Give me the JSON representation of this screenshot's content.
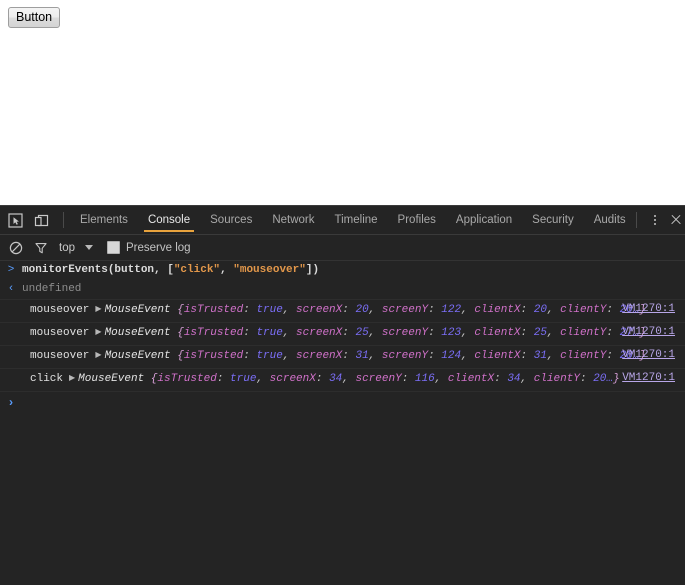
{
  "page": {
    "button_label": "Button"
  },
  "devtools": {
    "tools": {
      "inspect_icon": "inspect-element-picker-icon",
      "device_icon": "device-toolbar-icon"
    },
    "tabs": [
      {
        "label": "Elements",
        "active": false
      },
      {
        "label": "Console",
        "active": true
      },
      {
        "label": "Sources",
        "active": false
      },
      {
        "label": "Network",
        "active": false
      },
      {
        "label": "Timeline",
        "active": false
      },
      {
        "label": "Profiles",
        "active": false
      },
      {
        "label": "Application",
        "active": false
      },
      {
        "label": "Security",
        "active": false
      },
      {
        "label": "Audits",
        "active": false
      }
    ],
    "right_controls": {
      "more_label": "more-options",
      "close_label": "close"
    },
    "filterbar": {
      "clear_icon": "clear-console-icon",
      "filter_icon": "filter-funnel-icon",
      "context": "top",
      "preserve_log_label": "Preserve log",
      "preserve_log_checked": false
    },
    "console": {
      "input_expression_prefix": "monitorEvents(button, [",
      "input_string_1": "\"click\"",
      "input_comma": ", ",
      "input_string_2": "\"mouseover\"",
      "input_expression_suffix": "])",
      "result": "undefined",
      "input_marker": ">",
      "output_marker": "‹",
      "prompt_marker": "›",
      "rows": [
        {
          "event": "mouseover",
          "ctor": "MouseEvent",
          "open_brace": "{",
          "props": [
            {
              "name": "isTrusted",
              "value": "true",
              "type": "bool"
            },
            {
              "name": "screenX",
              "value": "20",
              "type": "num"
            },
            {
              "name": "screenY",
              "value": "122",
              "type": "num"
            },
            {
              "name": "clientX",
              "value": "20",
              "type": "num"
            },
            {
              "name": "clientY",
              "value": "26…",
              "type": "num"
            }
          ],
          "close_brace": "}",
          "source": "VM1270:1"
        },
        {
          "event": "mouseover",
          "ctor": "MouseEvent",
          "open_brace": "{",
          "props": [
            {
              "name": "isTrusted",
              "value": "true",
              "type": "bool"
            },
            {
              "name": "screenX",
              "value": "25",
              "type": "num"
            },
            {
              "name": "screenY",
              "value": "123",
              "type": "num"
            },
            {
              "name": "clientX",
              "value": "25",
              "type": "num"
            },
            {
              "name": "clientY",
              "value": "27…",
              "type": "num"
            }
          ],
          "close_brace": "}",
          "source": "VM1270:1"
        },
        {
          "event": "mouseover",
          "ctor": "MouseEvent",
          "open_brace": "{",
          "props": [
            {
              "name": "isTrusted",
              "value": "true",
              "type": "bool"
            },
            {
              "name": "screenX",
              "value": "31",
              "type": "num"
            },
            {
              "name": "screenY",
              "value": "124",
              "type": "num"
            },
            {
              "name": "clientX",
              "value": "31",
              "type": "num"
            },
            {
              "name": "clientY",
              "value": "28…",
              "type": "num"
            }
          ],
          "close_brace": "}",
          "source": "VM1270:1"
        },
        {
          "event": "click",
          "ctor": "MouseEvent",
          "open_brace": "{",
          "props": [
            {
              "name": "isTrusted",
              "value": "true",
              "type": "bool"
            },
            {
              "name": "screenX",
              "value": "34",
              "type": "num"
            },
            {
              "name": "screenY",
              "value": "116",
              "type": "num"
            },
            {
              "name": "clientX",
              "value": "34",
              "type": "num"
            },
            {
              "name": "clientY",
              "value": "20…",
              "type": "num"
            }
          ],
          "close_brace": "}",
          "source": "VM1270:1"
        }
      ]
    }
  },
  "colors": {
    "devtools_bg": "#242424",
    "tab_active_underline": "#e8a33d",
    "string_orange": "#e2974a",
    "prop_magenta": "#d071c9",
    "value_blue": "#7b6ef6",
    "link_lavender": "#b8a6e8",
    "marker_blue": "#5a9dfc"
  }
}
